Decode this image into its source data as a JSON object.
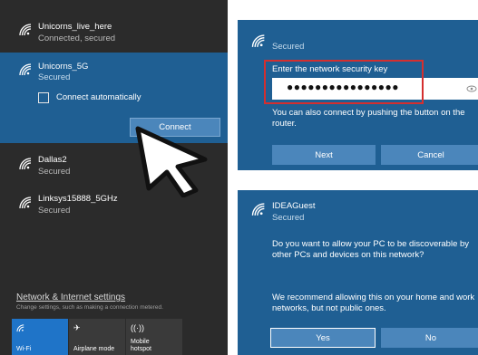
{
  "flyout": {
    "networks": [
      {
        "name": "Unicorns_live_here",
        "status": "Connected, secured"
      },
      {
        "name": "Unicorns_5G",
        "status": "Secured",
        "connect_auto_label": "Connect automatically",
        "connect_label": "Connect"
      },
      {
        "name": "Dallas2",
        "status": "Secured"
      },
      {
        "name": "Linksys15888_5GHz",
        "status": "Secured"
      }
    ],
    "settings_link": "Network & Internet settings",
    "settings_desc": "Change settings, such as making a connection metered.",
    "tiles": [
      {
        "label": "Wi-Fi",
        "icon": "wifi-icon"
      },
      {
        "label": "Airplane mode",
        "icon": "airplane-icon"
      },
      {
        "label": "Mobile hotspot",
        "label_lines": [
          "Mobile",
          "hotspot"
        ],
        "icon": "hotspot-icon"
      }
    ]
  },
  "key_dialog": {
    "status": "Secured",
    "key_label": "Enter the network security key",
    "key_value": "●●●●●●●●●●●●●●●●",
    "message": "You can also connect by pushing the button on the router.",
    "next_label": "Next",
    "cancel_label": "Cancel"
  },
  "discover_dialog": {
    "network_name": "IDEAGuest",
    "status": "Secured",
    "question": "Do you want to allow your PC to be discoverable by other PCs and devices on this network?",
    "recommendation": "We recommend allowing this on your home and work networks, but not public ones.",
    "yes_label": "Yes",
    "no_label": "No"
  },
  "colors": {
    "flyout_bg": "#2b2b2b",
    "selected_bg": "#1f5f93",
    "button_bg": "#4b86bb",
    "tile_active": "#1f74c8",
    "highlight": "#d42f2f"
  }
}
